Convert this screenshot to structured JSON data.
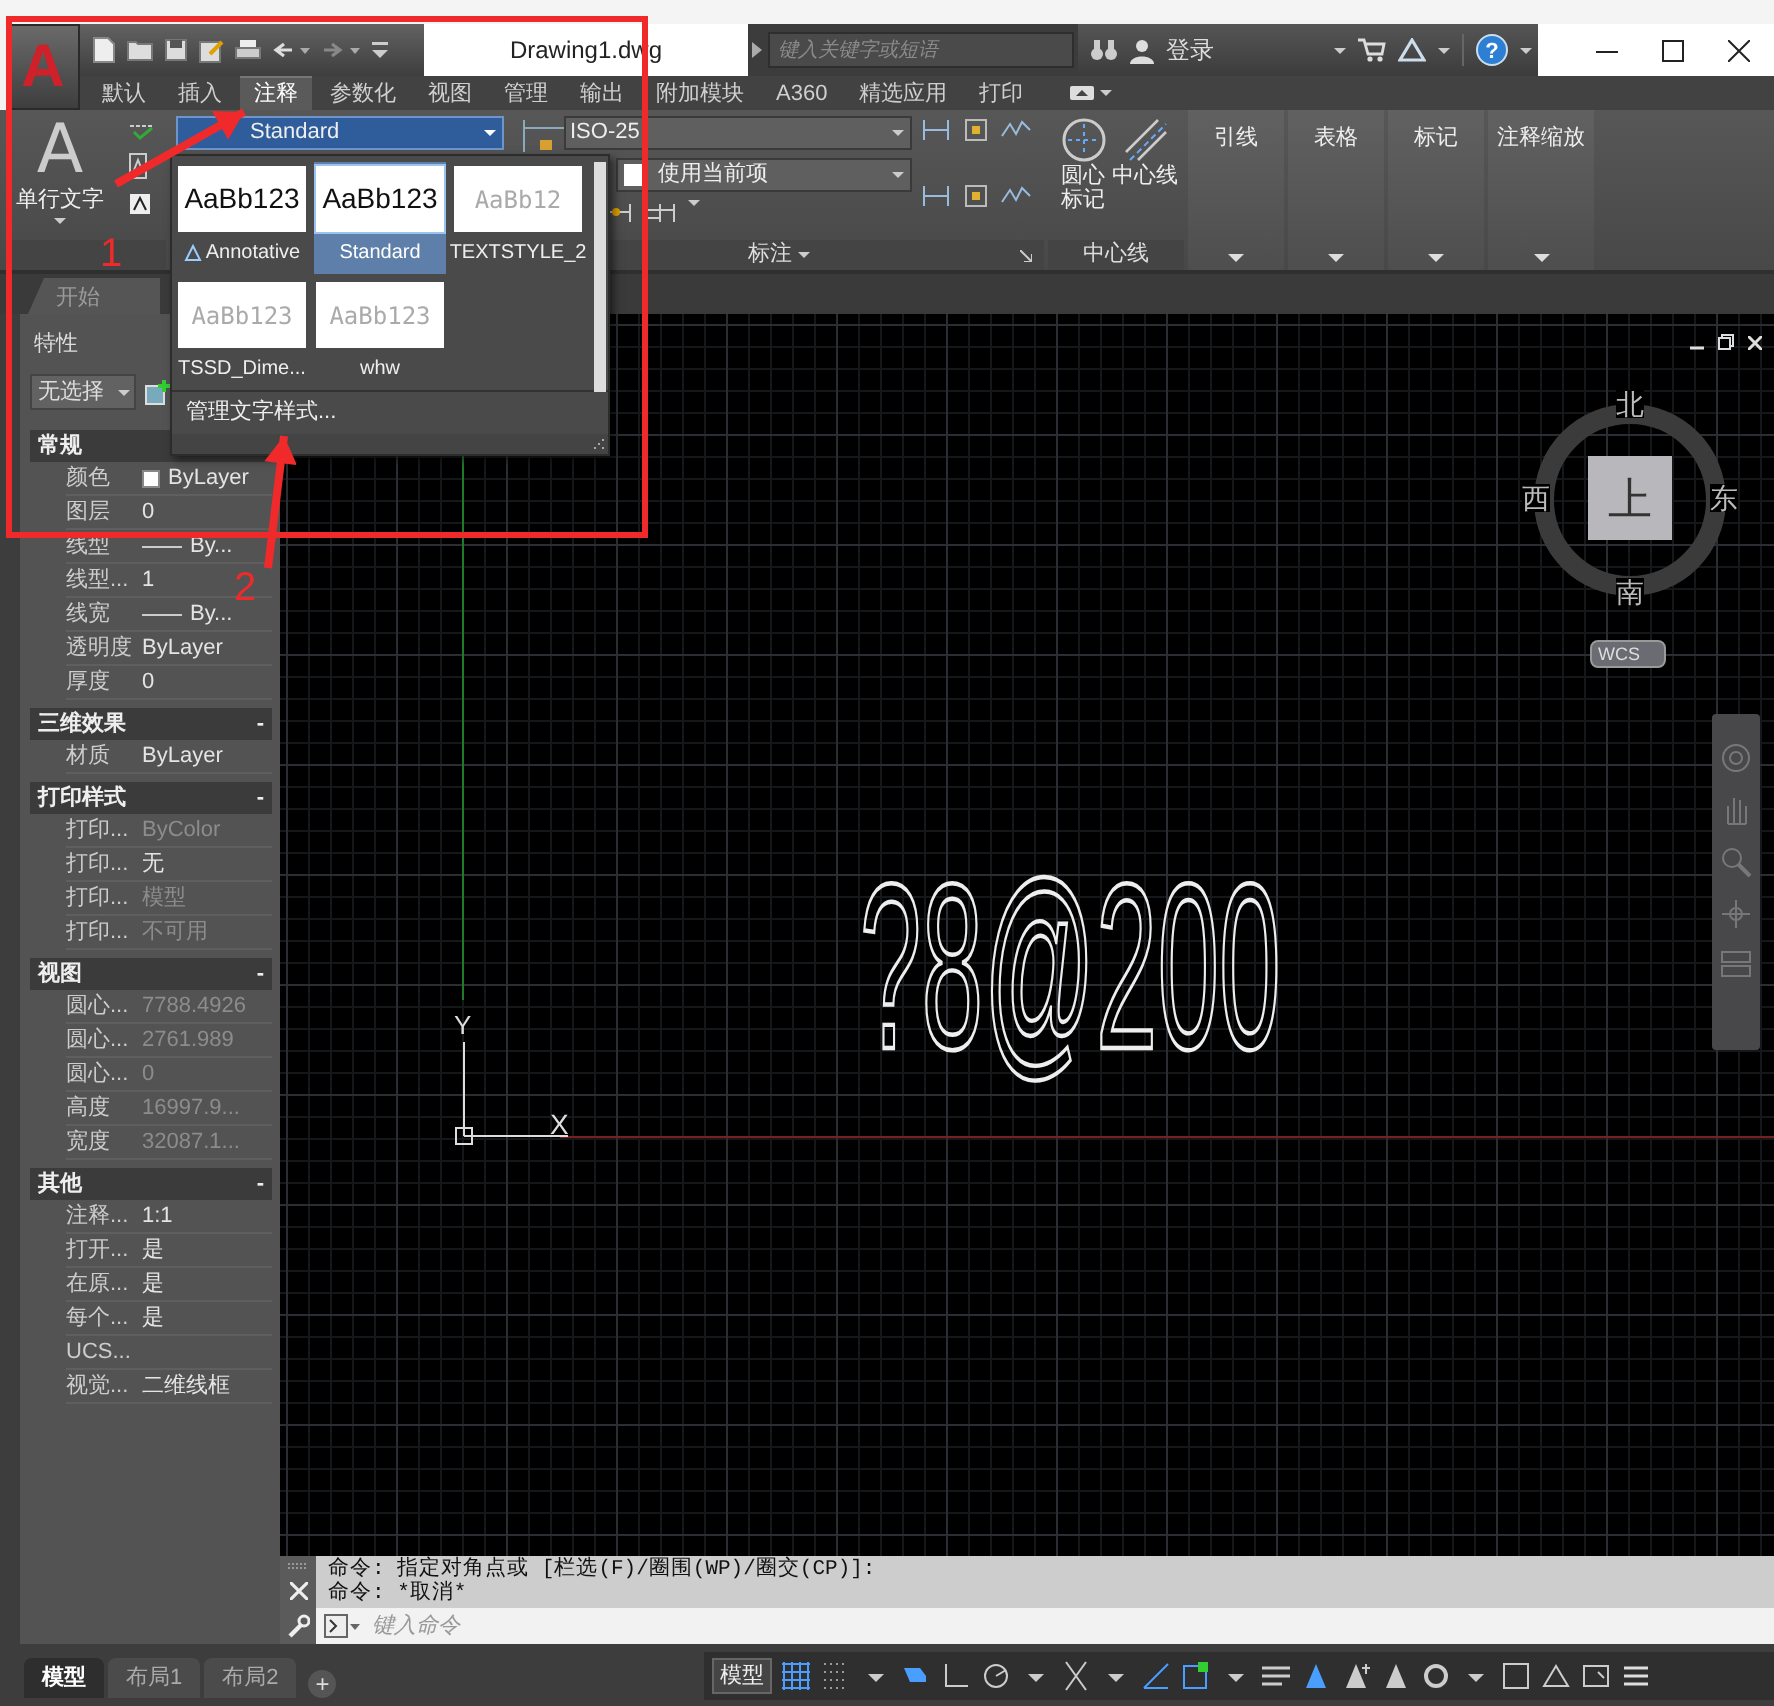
{
  "app": {
    "logo": "A",
    "title": "Drawing1.dwg",
    "search": {
      "placeholder": "键入关键字或短语"
    },
    "user": "登录",
    "help": "?"
  },
  "ribbon_tabs": [
    {
      "label": "默认",
      "selected": false
    },
    {
      "label": "插入",
      "selected": false
    },
    {
      "label": "注释",
      "selected": true
    },
    {
      "label": "参数化",
      "selected": false
    },
    {
      "label": "视图",
      "selected": false
    },
    {
      "label": "管理",
      "selected": false
    },
    {
      "label": "输出",
      "selected": false
    },
    {
      "label": "附加模块",
      "selected": false
    },
    {
      "label": "A360",
      "selected": false
    },
    {
      "label": "精选应用",
      "selected": false
    },
    {
      "label": "打印",
      "selected": false
    }
  ],
  "ribbon": {
    "text_panel": {
      "glyph": "A",
      "button": "单行文字"
    },
    "text_style": "Standard",
    "dimension_style": "ISO-25",
    "layer": "使用当前项",
    "dimension_panel": "标注",
    "centerline_panel": {
      "buttons": [
        "圆心标记",
        "中心线"
      ],
      "label": "中心线"
    },
    "collapsed_panels": [
      "引线",
      "表格",
      "标记",
      "注释缩放"
    ]
  },
  "text_style_gallery": {
    "items": [
      {
        "name": "Annotative",
        "preview": "AaBb123",
        "kind": "regular",
        "annotative": true,
        "selected": false
      },
      {
        "name": "Standard",
        "preview": "AaBb123",
        "kind": "regular",
        "annotative": false,
        "selected": true
      },
      {
        "name": "TEXTSTYLE_2",
        "preview": "AaBb12",
        "kind": "light",
        "annotative": false,
        "selected": false
      },
      {
        "name": "TSSD_Dime...",
        "preview": "AaBb123",
        "kind": "light",
        "annotative": false,
        "selected": false
      },
      {
        "name": "whw",
        "preview": "AaBb123",
        "kind": "light",
        "annotative": false,
        "selected": false
      }
    ],
    "manage": "管理文字样式..."
  },
  "file_tabs": [
    {
      "label": "开始"
    }
  ],
  "properties": {
    "title": "特性",
    "selection": "无选择",
    "sections": [
      {
        "title": "常规",
        "rows": [
          {
            "label": "颜色",
            "value": "ByLayer",
            "kind": "swatch",
            "disabled": false
          },
          {
            "label": "图层",
            "value": "0",
            "kind": "text",
            "disabled": false
          },
          {
            "label": "线型",
            "value": "By...",
            "kind": "line",
            "disabled": false
          },
          {
            "label": "线型...",
            "value": "1",
            "kind": "text",
            "disabled": false
          },
          {
            "label": "线宽",
            "value": "By...",
            "kind": "line",
            "disabled": false
          },
          {
            "label": "透明度",
            "value": "ByLayer",
            "kind": "text",
            "disabled": false
          },
          {
            "label": "厚度",
            "value": "0",
            "kind": "text",
            "disabled": false
          }
        ]
      },
      {
        "title": "三维效果",
        "toggle": "-",
        "rows": [
          {
            "label": "材质",
            "value": "ByLayer",
            "kind": "text",
            "disabled": false
          }
        ]
      },
      {
        "title": "打印样式",
        "toggle": "-",
        "rows": [
          {
            "label": "打印...",
            "value": "ByColor",
            "kind": "text",
            "disabled": true
          },
          {
            "label": "打印...",
            "value": "无",
            "kind": "text",
            "disabled": false
          },
          {
            "label": "打印...",
            "value": "模型",
            "kind": "text",
            "disabled": true
          },
          {
            "label": "打印...",
            "value": "不可用",
            "kind": "text",
            "disabled": true
          }
        ]
      },
      {
        "title": "视图",
        "toggle": "-",
        "rows": [
          {
            "label": "圆心...",
            "value": "7788.4926",
            "kind": "text",
            "disabled": true
          },
          {
            "label": "圆心...",
            "value": "2761.989",
            "kind": "text",
            "disabled": true
          },
          {
            "label": "圆心...",
            "value": "0",
            "kind": "text",
            "disabled": true
          },
          {
            "label": "高度",
            "value": "16997.9...",
            "kind": "text",
            "disabled": true
          },
          {
            "label": "宽度",
            "value": "32087.1...",
            "kind": "text",
            "disabled": true
          }
        ]
      },
      {
        "title": "其他",
        "toggle": "-",
        "rows": [
          {
            "label": "注释...",
            "value": "1:1",
            "kind": "text",
            "disabled": false
          },
          {
            "label": "打开...",
            "value": "是",
            "kind": "text",
            "disabled": false
          },
          {
            "label": "在原...",
            "value": "是",
            "kind": "text",
            "disabled": false
          },
          {
            "label": "每个...",
            "value": "是",
            "kind": "text",
            "disabled": false
          },
          {
            "label": "UCS...",
            "kind": "text",
            "disabled": false
          },
          {
            "label": "视觉...",
            "value": "二维线框",
            "kind": "text",
            "disabled": false
          }
        ]
      }
    ]
  },
  "canvas": {
    "text": "?8@200",
    "ucs": {
      "x": "X",
      "y": "Y"
    },
    "viewcube": {
      "north": "北",
      "east": "东",
      "south": "南",
      "west": "西",
      "face": "上",
      "system": "WCS"
    }
  },
  "command": {
    "history": [
      "命令: 指定对角点或 [栏选(F)/圈围(WP)/圈交(CP)]:",
      "命令: *取消*"
    ],
    "placeholder": "键入命令"
  },
  "layout_tabs": [
    {
      "label": "模型",
      "selected": true
    },
    {
      "label": "布局1",
      "selected": false
    },
    {
      "label": "布局2",
      "selected": false
    }
  ],
  "add_layout": "+",
  "status_bar": {
    "space": "模型"
  },
  "callouts": [
    {
      "label": "1"
    },
    {
      "label": "2"
    }
  ]
}
